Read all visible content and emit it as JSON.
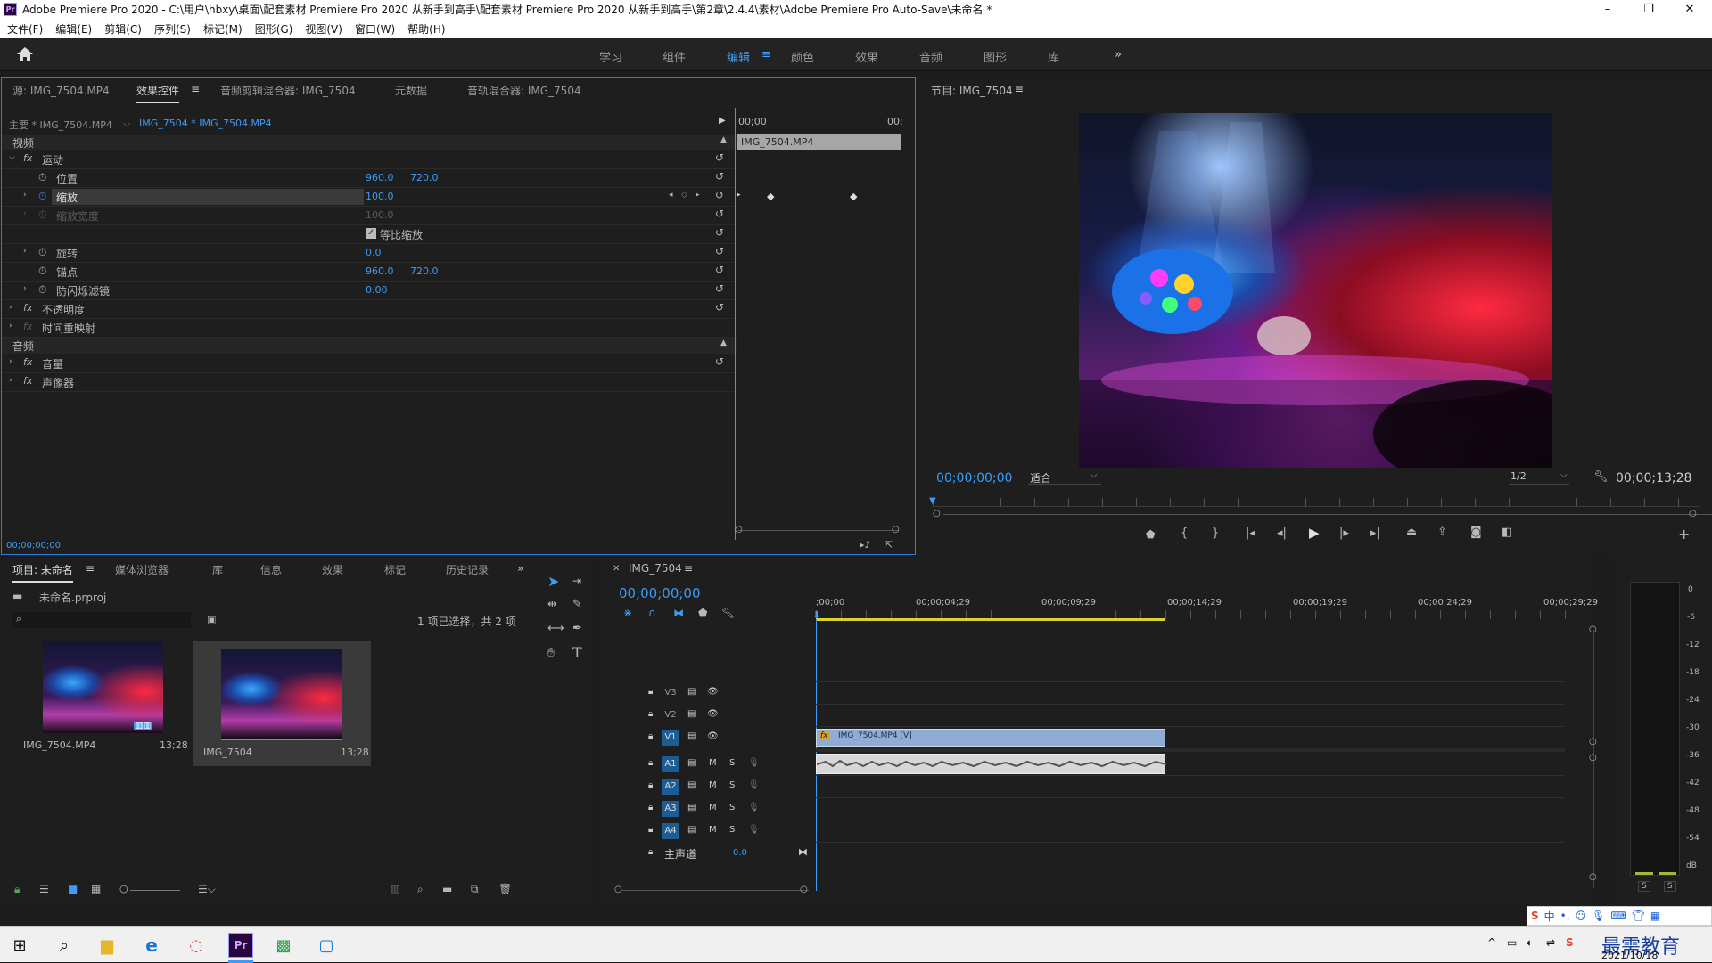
{
  "window": {
    "title": "Adobe Premiere Pro 2020 - C:\\用户\\hbxy\\桌面\\配套素材 Premiere Pro 2020 从新手到高手\\配套素材 Premiere Pro 2020 从新手到高手\\第2章\\2.4.4\\素材\\Adobe Premiere Pro Auto-Save\\未命名 *",
    "app_badge": "Pr"
  },
  "menu": [
    "文件(F)",
    "编辑(E)",
    "剪辑(C)",
    "序列(S)",
    "标记(M)",
    "图形(G)",
    "视图(V)",
    "窗口(W)",
    "帮助(H)"
  ],
  "workspaces": [
    "学习",
    "组件",
    "编辑",
    "颜色",
    "效果",
    "音频",
    "图形",
    "库"
  ],
  "active_workspace": "编辑",
  "source_panel": {
    "tabs": [
      "源: IMG_7504.MP4",
      "效果控件",
      "音频剪辑混合器: IMG_7504",
      "元数据",
      "音轨混合器: IMG_7504"
    ],
    "master": "主要 * IMG_7504.MP4",
    "clip": "IMG_7504 * IMG_7504.MP4",
    "timeline_start": "00;00",
    "timeline_end": "00;",
    "clip_bar": "IMG_7504.MP4",
    "section_video": "视频",
    "section_audio": "音频",
    "effects": [
      {
        "name": "运动",
        "fx": "fx"
      },
      {
        "name": "位置",
        "v1": "960.0",
        "v2": "720.0"
      },
      {
        "name": "缩放",
        "v1": "100.0"
      },
      {
        "name": "缩放宽度",
        "v1": "100.0"
      },
      {
        "name": "等比缩放"
      },
      {
        "name": "旋转",
        "v1": "0.0"
      },
      {
        "name": "锚点",
        "v1": "960.0",
        "v2": "720.0"
      },
      {
        "name": "防闪烁滤镜",
        "v1": "0.00"
      },
      {
        "name": "不透明度",
        "fx": "fx"
      },
      {
        "name": "时间重映射",
        "fx": "fx"
      },
      {
        "name": "音量",
        "fx": "fx"
      },
      {
        "name": "声像器",
        "fx": "fx"
      }
    ],
    "timecode": "00;00;00;00"
  },
  "program": {
    "title": "节目: IMG_7504",
    "timecode": "00;00;00;00",
    "fit": "适合",
    "quality": "1/2",
    "duration": "00;00;13;28"
  },
  "project": {
    "tabs": [
      "项目: 未命名",
      "媒体浏览器",
      "库",
      "信息",
      "效果",
      "标记",
      "历史记录"
    ],
    "file": "未命名.prproj",
    "count": "1 项已选择，共 2 项",
    "items": [
      {
        "name": "IMG_7504.MP4",
        "dur": "13;28"
      },
      {
        "name": "IMG_7504",
        "dur": "13;28"
      }
    ]
  },
  "timeline": {
    "title": "IMG_7504",
    "timecode": "00;00;00;00",
    "ruler": [
      ";00;00",
      "00;00;04;29",
      "00;00;09;29",
      "00;00;14;29",
      "00;00;19;29",
      "00;00;24;29",
      "00;00;29;29"
    ],
    "video_tracks": [
      "V3",
      "V2",
      "V1"
    ],
    "audio_tracks": [
      "A1",
      "A2",
      "A3",
      "A4"
    ],
    "master": "主声道",
    "master_val": "0.0",
    "clip_label": "IMG_7504.MP4 [V]",
    "m": "M",
    "s": "S"
  },
  "meter": {
    "ticks": [
      "0",
      "-6",
      "-12",
      "-18",
      "-24",
      "-30",
      "-36",
      "-42",
      "-48",
      "-54",
      "dB"
    ],
    "s": "S"
  },
  "taskbar": {
    "date": "2021/10/18",
    "ime": "中",
    "watermark": "最需教育"
  },
  "colors": {
    "accent": "#3d9bf7",
    "clip_video": "#8eacd4",
    "clip_audio": "#d7d7d7"
  }
}
